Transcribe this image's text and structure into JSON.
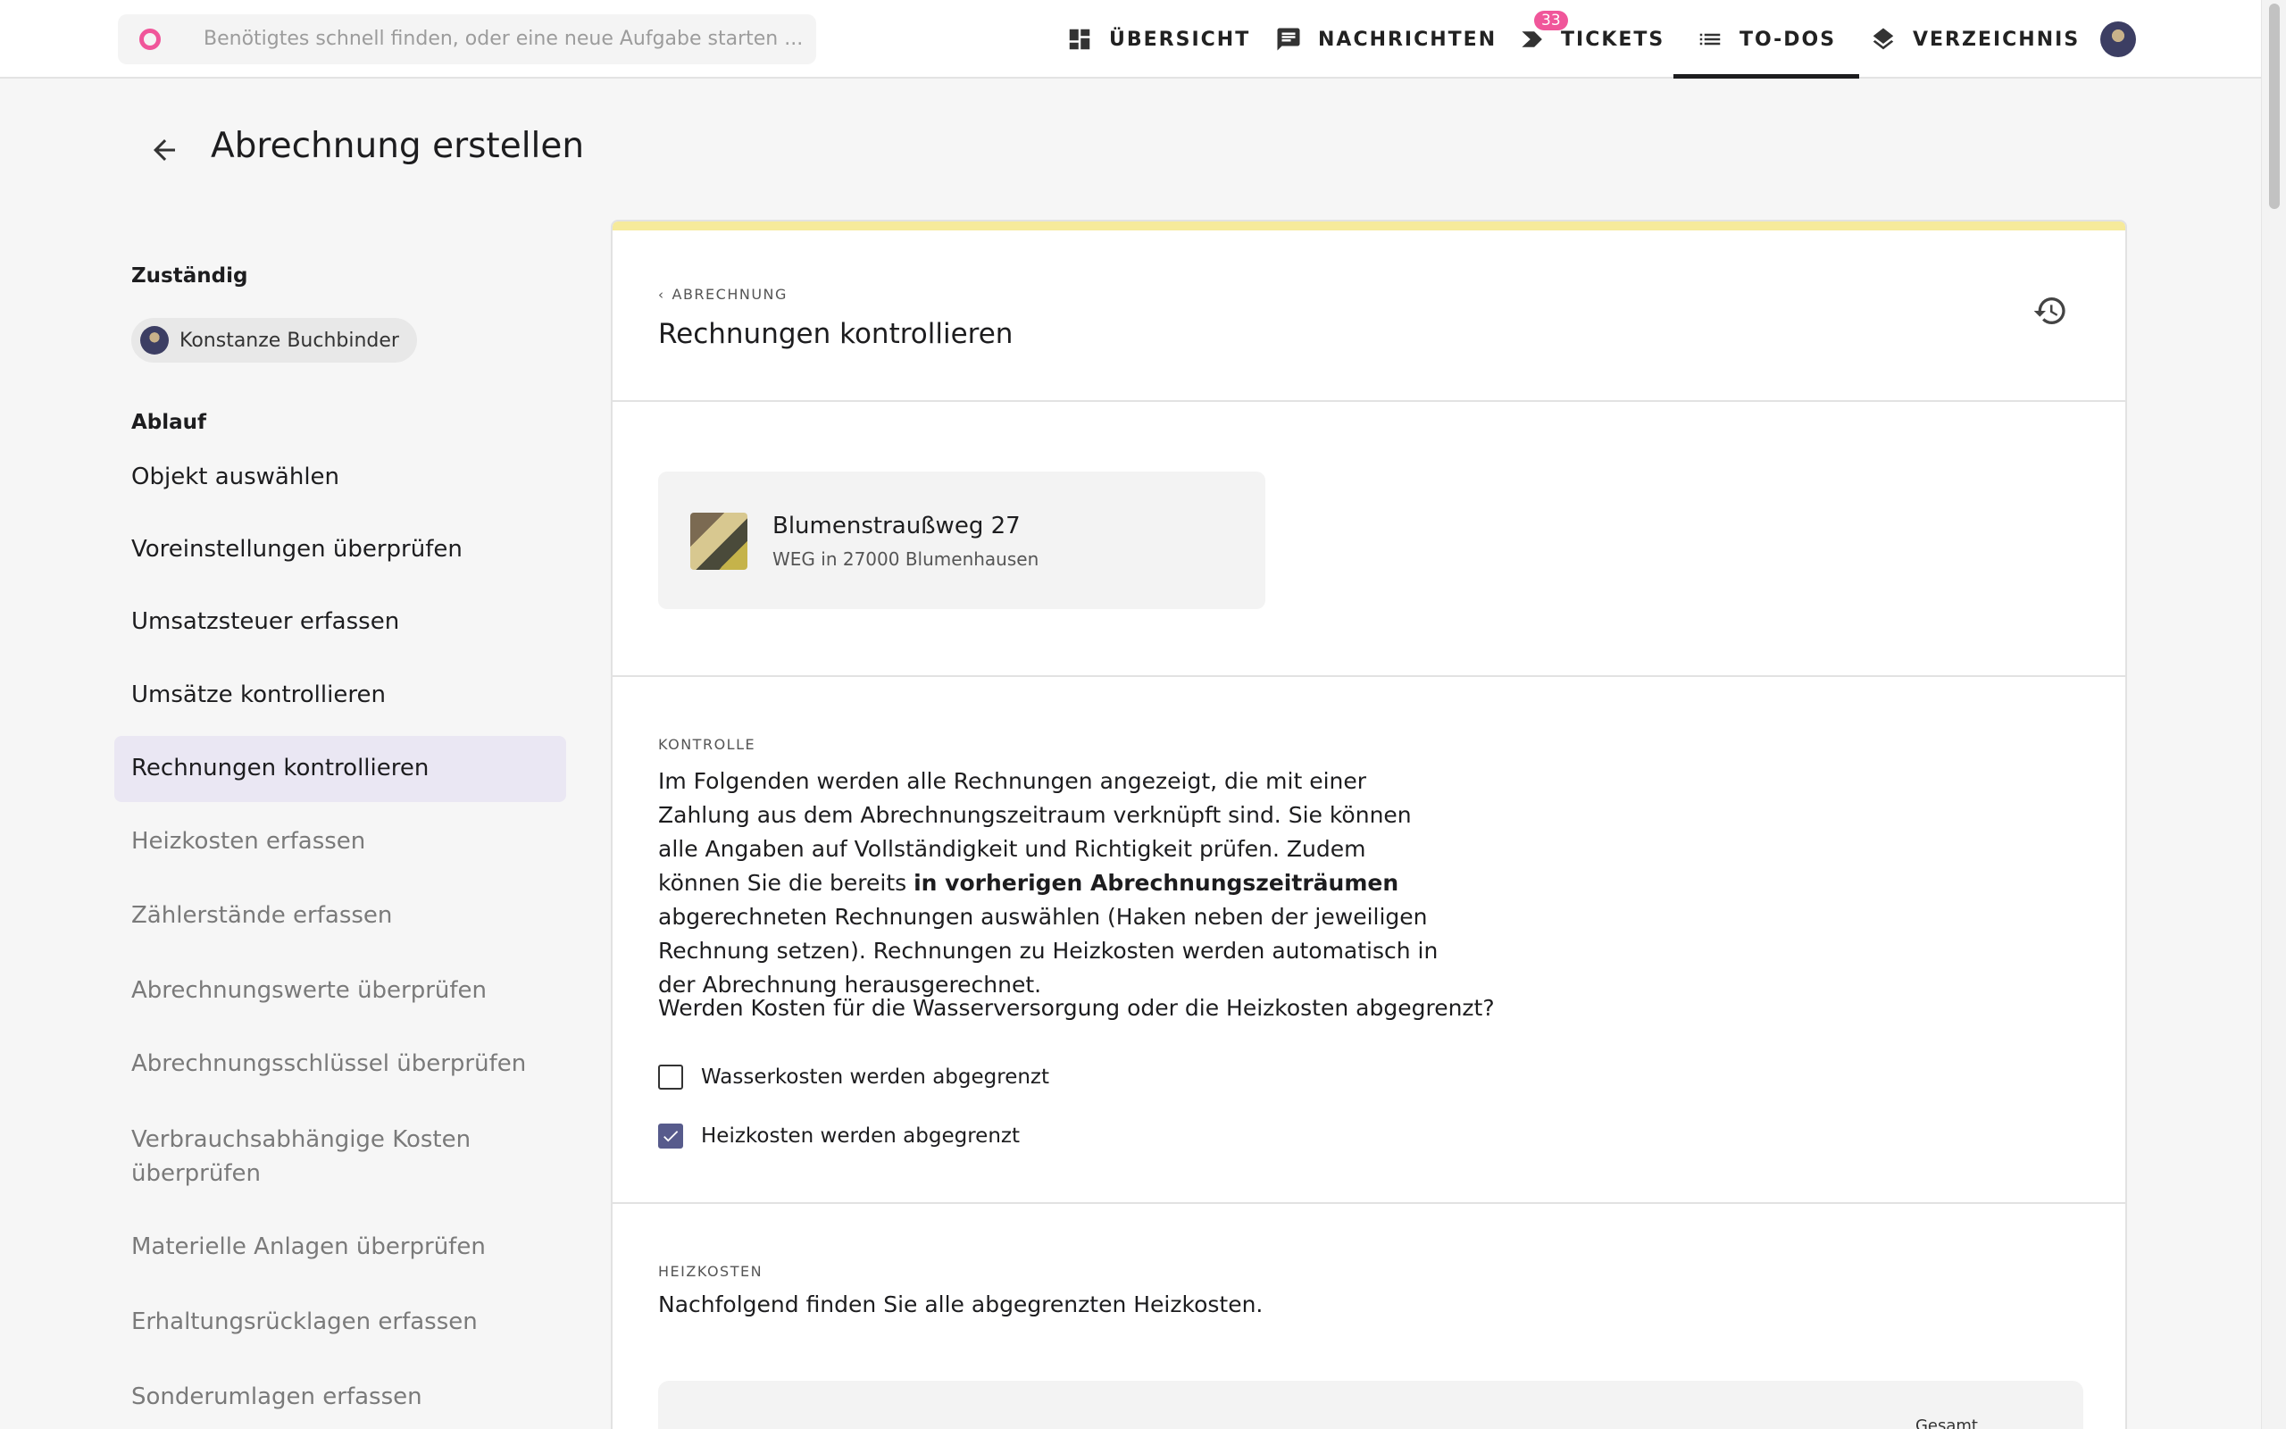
{
  "search": {
    "placeholder": "Benötigtes schnell finden, oder eine neue Aufgabe starten ..."
  },
  "nav": {
    "items": [
      {
        "label": "ÜBERSICHT",
        "icon": "dashboard-icon"
      },
      {
        "label": "NACHRICHTEN",
        "icon": "message-icon"
      },
      {
        "label": "TICKETS",
        "icon": "ticket-icon",
        "badge": "33"
      },
      {
        "label": "TO-DOS",
        "icon": "list-icon",
        "active": true
      },
      {
        "label": "VERZEICHNIS",
        "icon": "layers-icon"
      }
    ]
  },
  "page": {
    "title": "Abrechnung erstellen"
  },
  "sidebar": {
    "responsible_label": "Zuständig",
    "responsible_name": "Konstanze Buchbinder",
    "flow_label": "Ablauf",
    "steps": [
      {
        "label": "Objekt auswählen",
        "state": "done"
      },
      {
        "label": "Voreinstellungen überprüfen",
        "state": "done"
      },
      {
        "label": "Umsatzsteuer erfassen",
        "state": "done"
      },
      {
        "label": "Umsätze kontrollieren",
        "state": "done"
      },
      {
        "label": "Rechnungen kontrollieren",
        "state": "active"
      },
      {
        "label": "Heizkosten erfassen",
        "state": "future"
      },
      {
        "label": "Zählerstände erfassen",
        "state": "future"
      },
      {
        "label": "Abrechnungswerte überprüfen",
        "state": "future"
      },
      {
        "label": "Abrechnungsschlüssel überprüfen",
        "state": "future"
      },
      {
        "label": "Verbrauchsabhängige Kosten überprüfen",
        "state": "future"
      },
      {
        "label": "Materielle Anlagen überprüfen",
        "state": "future"
      },
      {
        "label": "Erhaltungsrücklagen erfassen",
        "state": "future"
      },
      {
        "label": "Sonderumlagen erfassen",
        "state": "future"
      }
    ]
  },
  "card": {
    "breadcrumb": "ABRECHNUNG",
    "title": "Rechnungen kontrollieren",
    "property": {
      "name": "Blumenstraußweg 27",
      "subtitle": "WEG in 27000 Blumenhausen"
    },
    "control": {
      "overline": "KONTROLLE",
      "text_1": "Im Folgenden werden alle Rechnungen angezeigt, die mit einer Zahlung aus dem Abrechnungszeitraum verknüpft sind. Sie können alle Angaben auf Vollständigkeit und Richtigkeit prüfen. Zudem können Sie die bereits ",
      "text_bold": "in vorherigen Abrechnungszeiträumen",
      "text_2": " abgerechneten Rechnungen auswählen (Haken neben der jeweiligen Rechnung setzen). Rechnungen zu Heizkosten werden automatisch in der Abrechnung herausgerechnet.",
      "question": "Werden Kosten für die Wasserversorgung oder die Heizkosten abgegrenzt?",
      "checkboxes": [
        {
          "label": "Wasserkosten werden abgegrenzt",
          "checked": false
        },
        {
          "label": "Heizkosten werden abgegrenzt",
          "checked": true
        }
      ]
    },
    "heating": {
      "overline": "HEIZKOSTEN",
      "text": "Nachfolgend finden Sie alle abgegrenzten Heizkosten.",
      "table_header_total": "Gesamt"
    }
  },
  "colors": {
    "accent": "#575b8c",
    "brand": "#f0569a",
    "card_topline": "#f6ea9b",
    "active_step_bg": "#eae7f3"
  }
}
